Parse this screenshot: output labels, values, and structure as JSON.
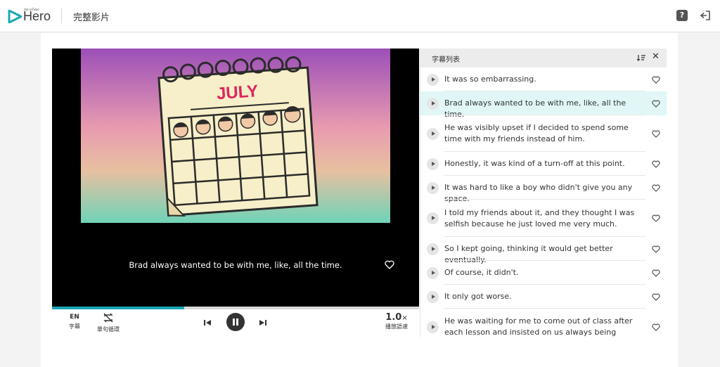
{
  "brand": {
    "logo_text": "Hero",
    "logo_small": "VoiceTube",
    "accent": "#1aa5b5"
  },
  "header": {
    "page_title": "完整影片",
    "help_icon": "question-icon",
    "logout_icon": "logout-icon"
  },
  "video": {
    "illustration_text": "JULY",
    "current_subtitle": "Brad always wanted to be with me, like, all the time.",
    "progress": 0.36
  },
  "controls": {
    "subtitle_lang": "EN",
    "subtitle_label": "字幕",
    "loop_label": "單句循環",
    "speed_value": "1.0",
    "speed_unit": "×",
    "speed_label": "播放語速"
  },
  "panel": {
    "title": "字幕列表",
    "items": [
      {
        "text": "It was so embarrassing.",
        "active": false
      },
      {
        "text": "Brad always wanted to be with me, like, all the time.",
        "active": true
      },
      {
        "text": "He was visibly upset if I decided to spend some time with my friends instead of him.",
        "active": false
      },
      {
        "text": "Honestly, it was kind of a turn-off at this point.",
        "active": false
      },
      {
        "text": "It was hard to like a boy who didn't give you any space.",
        "active": false
      },
      {
        "text": "I told my friends about it, and they thought I was selfish because he just loved me very much.",
        "active": false
      },
      {
        "text": "So I kept going, thinking it would get better eventually.",
        "active": false
      },
      {
        "text": "Of course, it didn't.",
        "active": false
      },
      {
        "text": "It only got worse.",
        "active": false
      },
      {
        "text": "He was waiting for me to come out of class after each lesson and insisted on us always being together.",
        "active": false
      }
    ]
  }
}
